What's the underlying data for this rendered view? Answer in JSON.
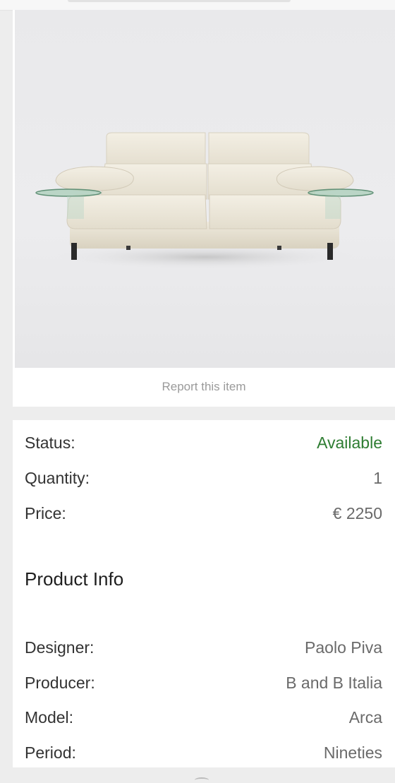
{
  "image": {
    "alt": "Cream leather sofa with glass side tables",
    "report_label": "Report this item"
  },
  "status": {
    "label": "Status:",
    "value": "Available",
    "value_color": "#2e7d32"
  },
  "quantity": {
    "label": "Quantity:",
    "value": "1"
  },
  "price": {
    "label": "Price:",
    "value": "€ 2250"
  },
  "product_info": {
    "title": "Product Info",
    "rows": [
      {
        "label": "Designer:",
        "value": "Paolo Piva"
      },
      {
        "label": "Producer:",
        "value": "B and B Italia"
      },
      {
        "label": "Model:",
        "value": "Arca"
      },
      {
        "label": "Period:",
        "value": "Nineties"
      }
    ]
  }
}
